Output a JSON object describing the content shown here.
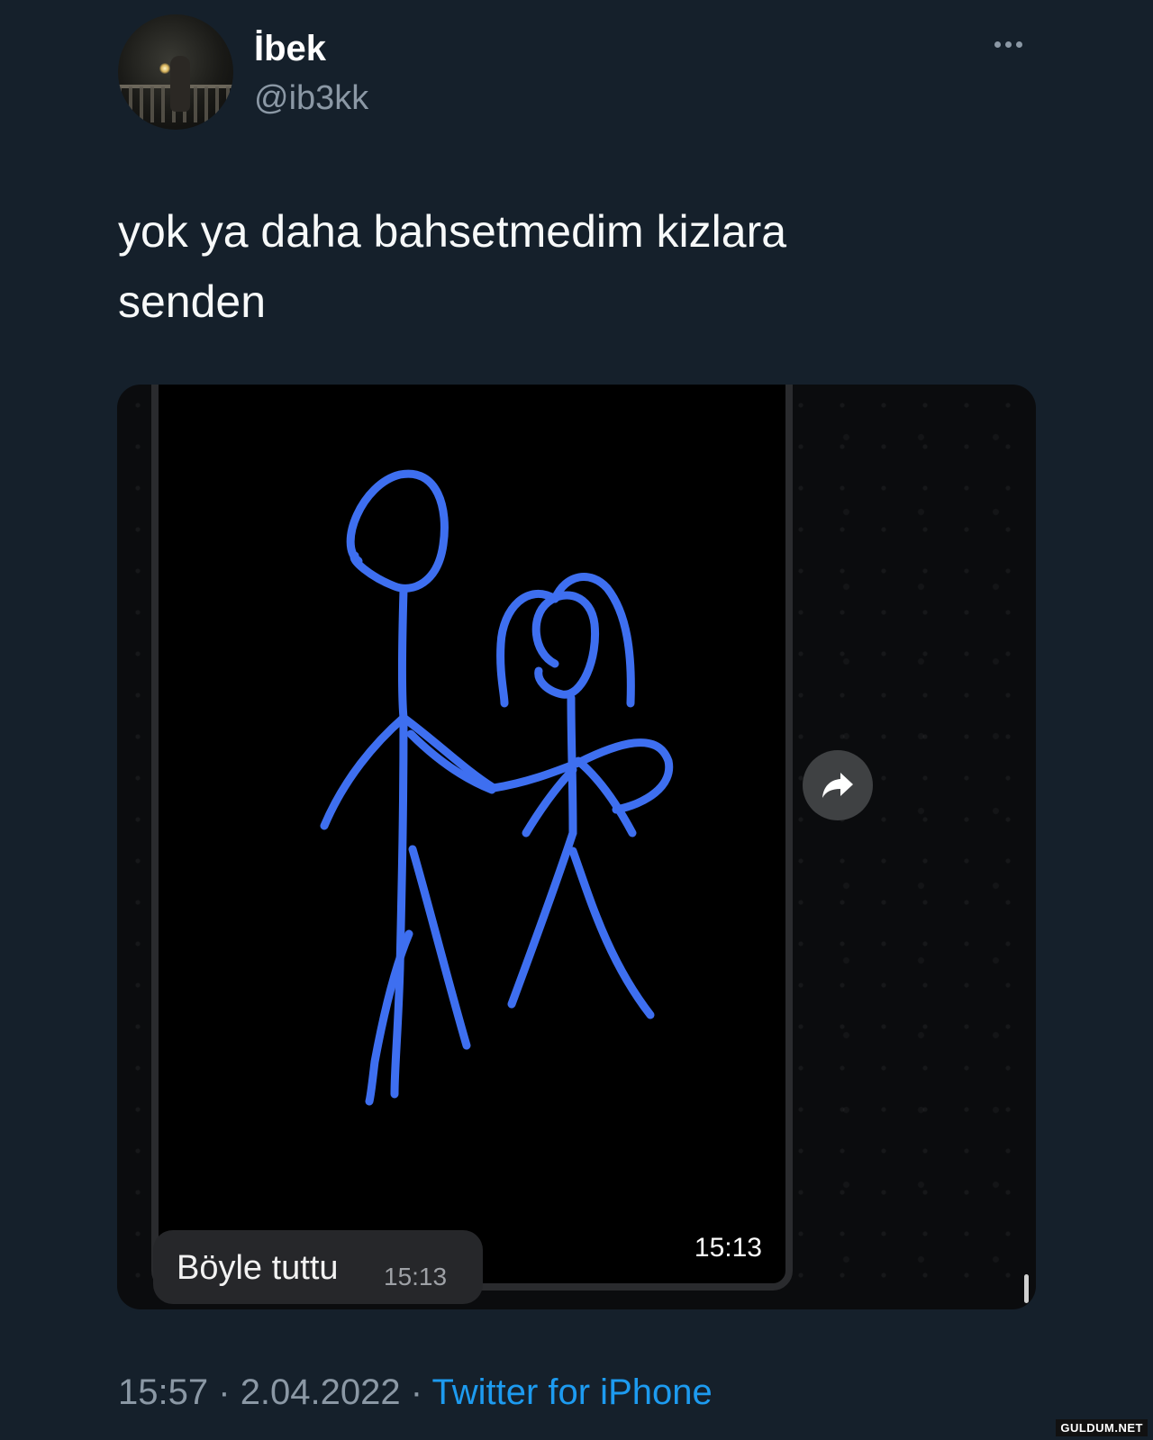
{
  "user": {
    "display_name": "İbek",
    "handle": "@ib3kk"
  },
  "tweet": {
    "text_line1": "yok ya daha bahsetmedim kizlara",
    "text_line2": "senden"
  },
  "media": {
    "image_message_time": "15:13",
    "text_message": "Böyle tuttu",
    "text_message_time": "15:13",
    "drawing_color": "#3e6ff0"
  },
  "meta": {
    "time": "15:57",
    "separator": "·",
    "date": "2.04.2022",
    "source": "Twitter for iPhone"
  },
  "watermark": "GULDUM.NET",
  "colors": {
    "background": "#15202b",
    "link": "#1d9bf0",
    "secondary_text": "#8b98a5"
  }
}
